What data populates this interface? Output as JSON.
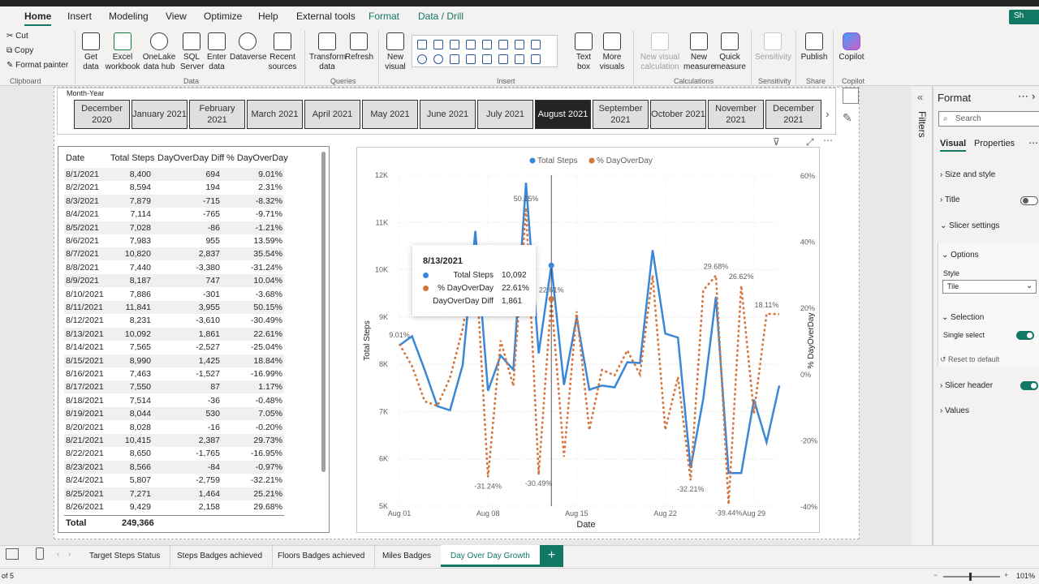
{
  "menu": {
    "tabs": [
      "Home",
      "Insert",
      "Modeling",
      "View",
      "Optimize",
      "Help",
      "External tools",
      "Format",
      "Data / Drill"
    ],
    "share": "Sh"
  },
  "ribbon": {
    "clipboard": {
      "cut": "Cut",
      "copy": "Copy",
      "painter": "Format painter",
      "label": "Clipboard"
    },
    "data_items": [
      "Get data",
      "Excel workbook",
      "OneLake data hub",
      "SQL Server",
      "Enter data",
      "Dataverse",
      "Recent sources"
    ],
    "data_label": "Data",
    "queries_items": [
      "Transform data",
      "Refresh"
    ],
    "queries_label": "Queries",
    "insert_items": [
      "New visual",
      "Text box",
      "More visuals"
    ],
    "insert_label": "Insert",
    "calc_items": [
      "New visual calculation",
      "New measure",
      "Quick measure"
    ],
    "calc_label": "Calculations",
    "sensitivity_items": [
      "Sensitivity"
    ],
    "sensitivity_label": "Sensitivity",
    "share_items": [
      "Publish"
    ],
    "share_label": "Share",
    "copilot_items": [
      "Copilot"
    ],
    "copilot_label": "Copilot"
  },
  "slicer": {
    "title": "Month-Year",
    "tiles": [
      "December 2020",
      "January 2021",
      "February 2021",
      "March 2021",
      "April 2021",
      "May 2021",
      "June 2021",
      "July 2021",
      "August 2021",
      "September 2021",
      "October 2021",
      "November 2021",
      "December 2021"
    ],
    "selected": "August 2021"
  },
  "table": {
    "headers": [
      "Date",
      "Total Steps",
      "DayOverDay Diff",
      "% DayOverDay"
    ],
    "rows": [
      [
        "8/1/2021",
        "8,400",
        "694",
        "9.01%"
      ],
      [
        "8/2/2021",
        "8,594",
        "194",
        "2.31%"
      ],
      [
        "8/3/2021",
        "7,879",
        "-715",
        "-8.32%"
      ],
      [
        "8/4/2021",
        "7,114",
        "-765",
        "-9.71%"
      ],
      [
        "8/5/2021",
        "7,028",
        "-86",
        "-1.21%"
      ],
      [
        "8/6/2021",
        "7,983",
        "955",
        "13.59%"
      ],
      [
        "8/7/2021",
        "10,820",
        "2,837",
        "35.54%"
      ],
      [
        "8/8/2021",
        "7,440",
        "-3,380",
        "-31.24%"
      ],
      [
        "8/9/2021",
        "8,187",
        "747",
        "10.04%"
      ],
      [
        "8/10/2021",
        "7,886",
        "-301",
        "-3.68%"
      ],
      [
        "8/11/2021",
        "11,841",
        "3,955",
        "50.15%"
      ],
      [
        "8/12/2021",
        "8,231",
        "-3,610",
        "-30.49%"
      ],
      [
        "8/13/2021",
        "10,092",
        "1,861",
        "22.61%"
      ],
      [
        "8/14/2021",
        "7,565",
        "-2,527",
        "-25.04%"
      ],
      [
        "8/15/2021",
        "8,990",
        "1,425",
        "18.84%"
      ],
      [
        "8/16/2021",
        "7,463",
        "-1,527",
        "-16.99%"
      ],
      [
        "8/17/2021",
        "7,550",
        "87",
        "1.17%"
      ],
      [
        "8/18/2021",
        "7,514",
        "-36",
        "-0.48%"
      ],
      [
        "8/19/2021",
        "8,044",
        "530",
        "7.05%"
      ],
      [
        "8/20/2021",
        "8,028",
        "-16",
        "-0.20%"
      ],
      [
        "8/21/2021",
        "10,415",
        "2,387",
        "29.73%"
      ],
      [
        "8/22/2021",
        "8,650",
        "-1,765",
        "-16.95%"
      ],
      [
        "8/23/2021",
        "8,566",
        "-84",
        "-0.97%"
      ],
      [
        "8/24/2021",
        "5,807",
        "-2,759",
        "-32.21%"
      ],
      [
        "8/25/2021",
        "7,271",
        "1,464",
        "25.21%"
      ],
      [
        "8/26/2021",
        "9,429",
        "2,158",
        "29.68%"
      ]
    ],
    "total_label": "Total",
    "total_value": "249,366"
  },
  "chart_data": {
    "type": "line",
    "legend": [
      "Total Steps",
      "% DayOverDay"
    ],
    "xlabel": "Date",
    "ylabel": "Total Steps",
    "y2label": "% DayOverDay",
    "x_ticks": [
      "Aug 01",
      "Aug 08",
      "Aug 15",
      "Aug 22",
      "Aug 29"
    ],
    "y_ticks": [
      "12K",
      "11K",
      "10K",
      "9K",
      "8K",
      "7K",
      "6K",
      "5K"
    ],
    "y2_ticks": [
      "60%",
      "40%",
      "20%",
      "0%",
      "-20%",
      "-40%"
    ],
    "ylim": [
      5000,
      12000
    ],
    "y2lim": [
      -40,
      60
    ],
    "series": [
      {
        "name": "Total Steps",
        "color": "#3a87d8",
        "values": [
          8400,
          8594,
          7879,
          7114,
          7028,
          7983,
          10820,
          7440,
          8187,
          7886,
          11841,
          8231,
          10092,
          7565,
          8990,
          7463,
          7550,
          7514,
          8044,
          8028,
          10415,
          8650,
          8566,
          5807,
          7271,
          9429,
          5700,
          5700,
          7250,
          6350,
          7550
        ]
      },
      {
        "name": "% DayOverDay",
        "color": "#d4743d",
        "values": [
          9.01,
          2.31,
          -8.32,
          -9.71,
          -1.21,
          13.59,
          35.54,
          -31.24,
          10.04,
          -3.68,
          50.15,
          -30.49,
          22.61,
          -25.04,
          18.84,
          -16.99,
          1.17,
          -0.48,
          7.05,
          -0.2,
          29.73,
          -16.95,
          -0.97,
          -32.21,
          25.21,
          29.68,
          -39.44,
          26.62,
          -12.0,
          18.11,
          18.0
        ]
      }
    ],
    "data_labels": [
      "9.01%",
      "-31.24%",
      "50.15%",
      "-30.49%",
      "29.68%",
      "-32.21%",
      "26.62%",
      "-39.44%",
      "18.11%",
      "22.61%"
    ]
  },
  "tooltip": {
    "date": "8/13/2021",
    "rows": [
      {
        "label": "Total Steps",
        "value": "10,092"
      },
      {
        "label": "% DayOverDay",
        "value": "22.61%"
      },
      {
        "label": "DayOverDay Diff",
        "value": "1,861"
      }
    ]
  },
  "format_pane": {
    "title": "Format",
    "search_placeholder": "Search",
    "tabs": [
      "Visual",
      "Properties"
    ],
    "sections": {
      "size_style": "Size and style",
      "title": "Title",
      "slicer_settings": "Slicer settings",
      "options": "Options",
      "style_label": "Style",
      "style_value": "Tile",
      "selection": "Selection",
      "single_select": "Single select",
      "reset": "Reset to default",
      "slicer_header": "Slicer header",
      "values": "Values"
    },
    "toggle_on": "On",
    "toggle_off": "Off",
    "filters_label": "Filters"
  },
  "pages": [
    "Target Steps Status",
    "Steps Badges achieved",
    "Floors Badges achieved",
    "Miles Badges",
    "Day Over Day Growth"
  ],
  "active_page": "Day Over Day Growth",
  "status": {
    "page": "of 5",
    "zoom": "101%"
  }
}
